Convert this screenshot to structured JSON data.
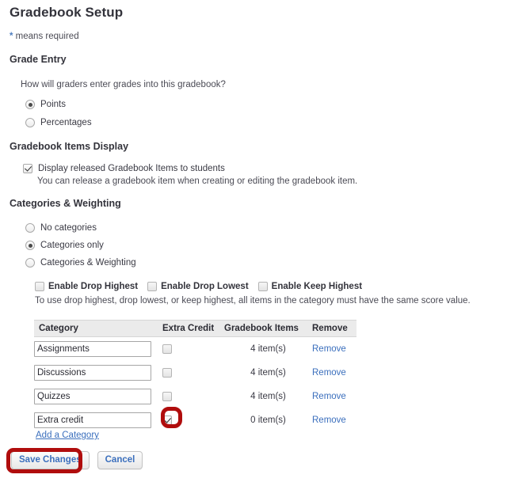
{
  "page": {
    "title": "Gradebook Setup",
    "required_note_star": "*",
    "required_note_text": " means required"
  },
  "grade_entry": {
    "section_title": "Grade Entry",
    "question": "How will graders enter grades into this gradebook?",
    "options": [
      {
        "label": "Points",
        "selected": true
      },
      {
        "label": "Percentages",
        "selected": false
      }
    ]
  },
  "items_display": {
    "section_title": "Gradebook Items Display",
    "checkbox_label": "Display released Gradebook Items to students",
    "checkbox_checked": true,
    "helper": "You can release a gradebook item when creating or editing the gradebook item."
  },
  "categories_weighting": {
    "section_title": "Categories & Weighting",
    "options": [
      {
        "label": "No categories",
        "selected": false
      },
      {
        "label": "Categories only",
        "selected": true
      },
      {
        "label": "Categories & Weighting",
        "selected": false
      }
    ],
    "drop_options": [
      {
        "label": "Enable Drop Highest",
        "checked": false
      },
      {
        "label": "Enable Drop Lowest",
        "checked": false
      },
      {
        "label": "Enable Keep Highest",
        "checked": false
      }
    ],
    "drop_helper": "To use drop highest, drop lowest, or keep highest, all items in the category must have the same score value.",
    "table": {
      "headers": [
        "Category",
        "Extra Credit",
        "Gradebook Items",
        "Remove"
      ],
      "rows": [
        {
          "category": "Assignments",
          "extra_credit": false,
          "items": "4 item(s)",
          "remove": "Remove",
          "highlight": false
        },
        {
          "category": "Discussions",
          "extra_credit": false,
          "items": "4 item(s)",
          "remove": "Remove",
          "highlight": false
        },
        {
          "category": "Quizzes",
          "extra_credit": false,
          "items": "4 item(s)",
          "remove": "Remove",
          "highlight": false
        },
        {
          "category": "Extra credit",
          "extra_credit": true,
          "items": "0 item(s)",
          "remove": "Remove",
          "highlight": true
        }
      ]
    },
    "add_category": "Add a Category"
  },
  "actions": {
    "save_label": "Save Changes",
    "cancel_label": "Cancel",
    "save_highlighted": true
  },
  "colors": {
    "annotation_red": "#b00d0d",
    "link_blue": "#3b6fbd",
    "header_gray": "#ebebeb"
  }
}
